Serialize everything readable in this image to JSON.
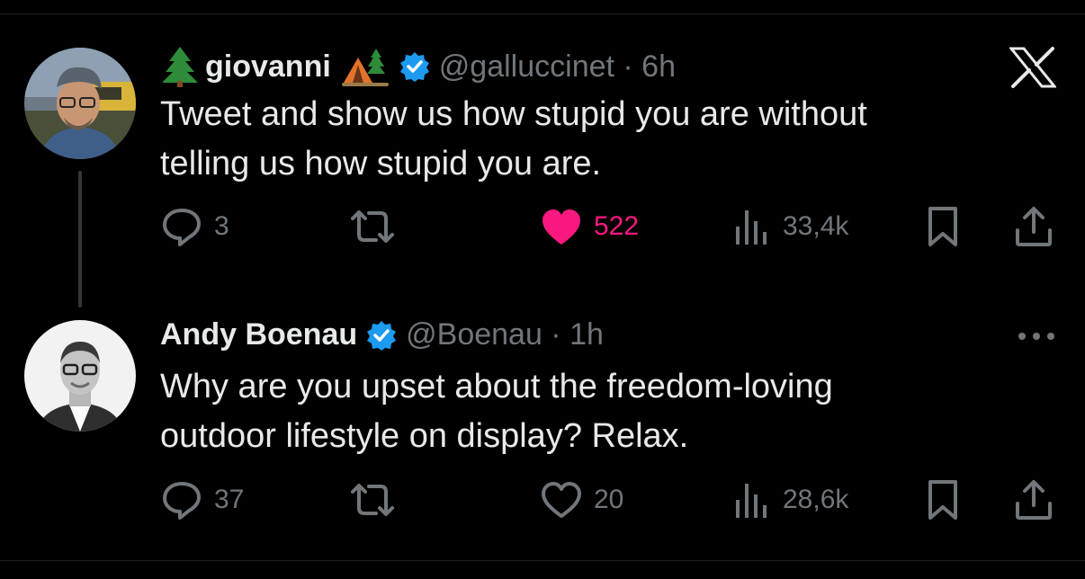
{
  "tweets": [
    {
      "name": "giovanni",
      "handle": "@galluccinet · 6h",
      "text_line1": "Tweet and show us how stupid you are without",
      "text_line2": "telling us how stupid you are.",
      "replies": "3",
      "retweets": "",
      "likes": "522",
      "views": "33,4k",
      "liked": true
    },
    {
      "name": "Andy Boenau",
      "handle": "@Boenau · 1h",
      "text_line1": "Why are you upset about the freedom-loving",
      "text_line2": "outdoor lifestyle on display? Relax.",
      "replies": "37",
      "retweets": "",
      "likes": "20",
      "views": "28,6k",
      "liked": false
    }
  ],
  "colors": {
    "background": "#000000",
    "text": "#e7e9ea",
    "muted": "#71767b",
    "like": "#f91880",
    "verified": "#1d9bf0"
  },
  "icons": [
    "x-logo-icon",
    "more-icon",
    "reply-icon",
    "retweet-icon",
    "heart-icon",
    "views-icon",
    "bookmark-icon",
    "share-icon",
    "verified-badge-icon",
    "tree-emoji",
    "tent-emoji"
  ]
}
